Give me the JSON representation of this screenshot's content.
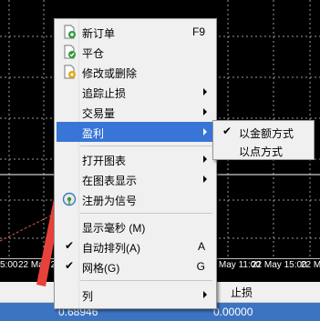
{
  "chart": {
    "time_labels": [
      "5:00",
      "22 May 23",
      "22 May 11:00",
      "22 May 15:00",
      "22 May"
    ]
  },
  "toolbox": {
    "col_stop": "止损",
    "row_values": [
      "0.68946",
      "0.00000"
    ]
  },
  "context_menu": {
    "new_order": "新订单",
    "new_order_shortcut": "F9",
    "close_position": "平仓",
    "modify_delete": "修改或删除",
    "trailing_stop": "追踪止损",
    "volume": "交易量",
    "profit": "盈利",
    "open_chart": "打开图表",
    "show_on_chart": "在图表显示",
    "register_signal": "注册为信号",
    "show_milliseconds": "显示毫秒 (M)",
    "auto_arrange": "自动排列(A)",
    "auto_arrange_shortcut": "A",
    "grid": "网格(G)",
    "grid_shortcut": "G",
    "columns": "列"
  },
  "profit_submenu": {
    "in_money": "以金额方式",
    "in_points": "以点方式"
  }
}
